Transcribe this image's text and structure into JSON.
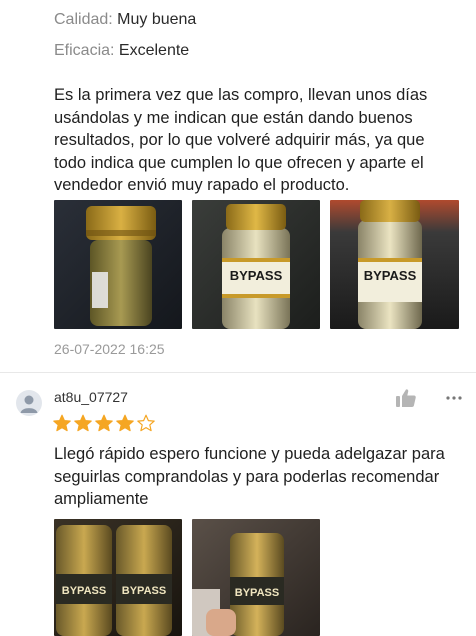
{
  "review1": {
    "quality_label": "Calidad:",
    "quality_value": "Muy buena",
    "efficacy_label": "Eficacia:",
    "efficacy_value": "Excelente",
    "text": "Es la primera vez que las compro, llevan unos días usándolas y me indican que están dando buenos resultados, por lo que volveré adquirir más, ya que todo indica que cumplen lo que ofrecen y aparte el vendedor envió muy rapado el producto.",
    "photo_labels": [
      "",
      "BYPASS",
      "BYPASS"
    ],
    "timestamp": "26-07-2022 16:25"
  },
  "review2": {
    "username": "at8u_07727",
    "rating": 4,
    "max_rating": 5,
    "text": "Llegó rápido espero funcione y pueda adelgazar para seguirlas comprandolas y para poderlas recomendar ampliamente",
    "photo_labels": [
      "BYPASS",
      "BYPASS"
    ]
  },
  "icons": {
    "avatar": "user-avatar-icon",
    "like": "thumbs-up-icon",
    "more": "more-options-icon",
    "star_filled": "star-filled-icon",
    "star_empty": "star-outline-icon"
  },
  "colors": {
    "star": "#f5a623",
    "muted_text": "#8a8a8a",
    "cap_gold": "#c89a2a"
  }
}
